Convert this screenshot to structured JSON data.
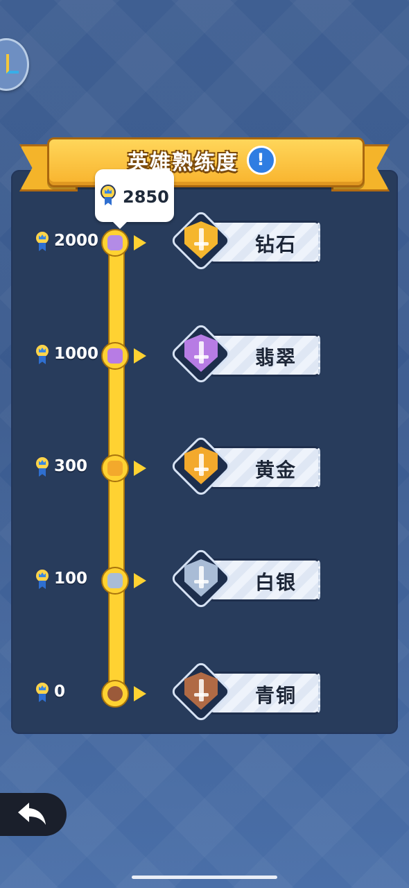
{
  "title": "英雄熟练度",
  "info_glyph": "!",
  "current_points": "2850",
  "colors": {
    "track": "#ffd232",
    "banner": "#f8b32d",
    "panel": "#283c5c",
    "background": "#3f5f92"
  },
  "tiers": [
    {
      "label": "钻石",
      "requirement": "2000",
      "color": "#f5b62e",
      "node_color": "#b38be6",
      "icon": "diamond-crossed-swords-badge-icon"
    },
    {
      "label": "翡翠",
      "requirement": "1000",
      "color": "#b77ce4",
      "node_color": "#b77ce4",
      "icon": "emerald-sword-badge-icon"
    },
    {
      "label": "黄金",
      "requirement": "300",
      "color": "#f3a92c",
      "node_color": "#f3a92c",
      "icon": "gold-sword-badge-icon"
    },
    {
      "label": "白银",
      "requirement": "100",
      "color": "#a9bcd6",
      "node_color": "#a9bcd6",
      "icon": "silver-sword-badge-icon"
    },
    {
      "label": "青铜",
      "requirement": "0",
      "color": "#b06a45",
      "node_color": "#9b5a3a",
      "icon": "bronze-sword-badge-icon"
    }
  ],
  "icons": {
    "back": "back-arrow-icon",
    "medal": "medal-icon",
    "info": "info-icon"
  }
}
